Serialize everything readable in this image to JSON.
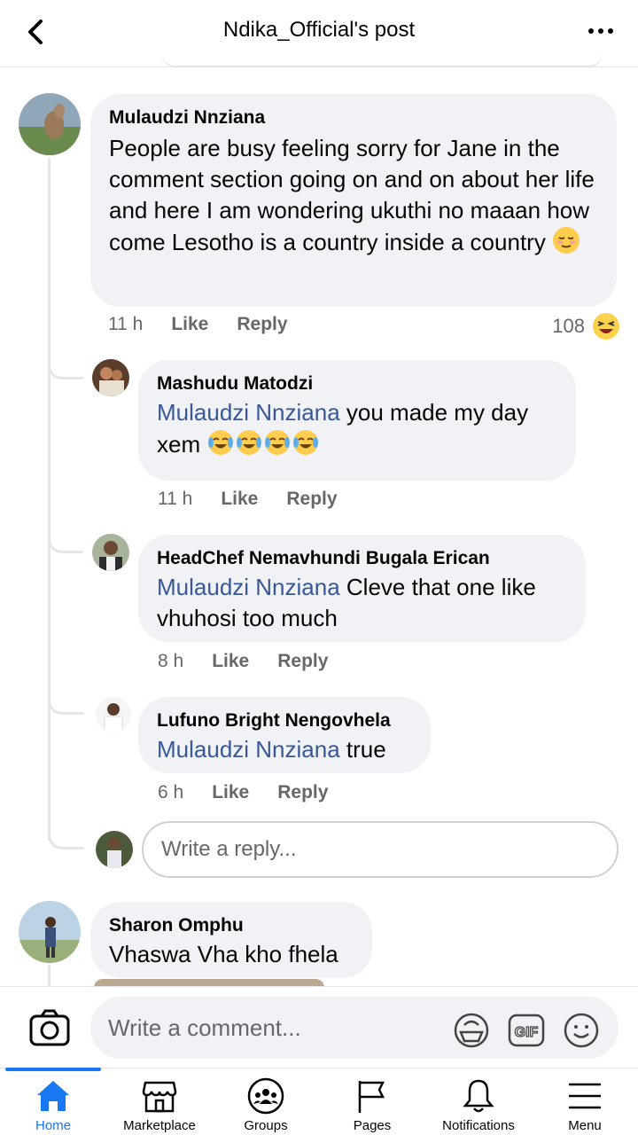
{
  "header": {
    "title": "Ndika_Official's post"
  },
  "comments": [
    {
      "author": "Mulaudzi Nnziana",
      "text": "People are busy feeling sorry for Jane in the comment section going on and on about her life and here I am wondering ukuthi no maaan how come Lesotho is a country inside a country",
      "emoji": "relieved-face",
      "time": "11 h",
      "like": "Like",
      "reply": "Reply",
      "reactions": "108",
      "reaction_icon": "laughing-face-icon",
      "replies": [
        {
          "author": "Mashudu Matodzi",
          "mention": "Mulaudzi Nnziana",
          "text": " you made my day xem ",
          "emoji": "tears-of-joy x4",
          "time": "11 h",
          "like": "Like",
          "reply": "Reply"
        },
        {
          "author": "HeadChef Nemavhundi Bugala Erican",
          "mention": "Mulaudzi Nnziana",
          "text": " Cleve that one like vhuhosi too much",
          "time": "8 h",
          "like": "Like",
          "reply": "Reply"
        },
        {
          "author": "Lufuno Bright Nengovhela",
          "mention": "Mulaudzi Nnziana",
          "text": " true",
          "time": "6 h",
          "like": "Like",
          "reply": "Reply"
        }
      ],
      "reply_placeholder": "Write a reply..."
    },
    {
      "author": "Sharon Omphu",
      "text": "Vhaswa Vha kho fhela"
    }
  ],
  "comment_bar": {
    "placeholder": "Write a comment..."
  },
  "nav": [
    {
      "label": "Home",
      "icon": "home-icon",
      "active": true
    },
    {
      "label": "Marketplace",
      "icon": "marketplace-icon"
    },
    {
      "label": "Groups",
      "icon": "groups-icon"
    },
    {
      "label": "Pages",
      "icon": "pages-icon"
    },
    {
      "label": "Notifications",
      "icon": "bell-icon"
    },
    {
      "label": "Menu",
      "icon": "menu-icon"
    }
  ],
  "colors": {
    "accent": "#1877f2",
    "mention": "#385898",
    "bubble": "#f0f2f5",
    "muted": "#65676b"
  }
}
